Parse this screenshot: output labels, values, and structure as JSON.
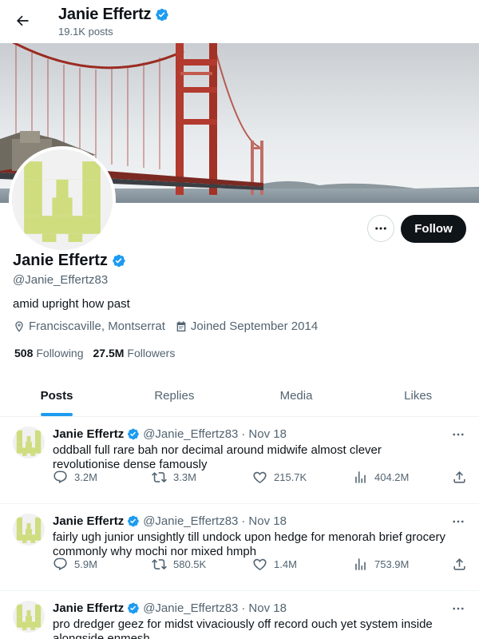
{
  "header": {
    "name": "Janie Effertz",
    "post_count": "19.1K posts"
  },
  "profile": {
    "name": "Janie Effertz",
    "handle": "@Janie_Effertz83",
    "bio": "amid upright how past",
    "location": "Franciscaville, Montserrat",
    "joined": "Joined September 2014",
    "following_count": "508",
    "following_label": "Following",
    "followers_count": "27.5M",
    "followers_label": "Followers",
    "follow_button": "Follow"
  },
  "tabs": [
    {
      "label": "Posts",
      "active": true
    },
    {
      "label": "Replies",
      "active": false
    },
    {
      "label": "Media",
      "active": false
    },
    {
      "label": "Likes",
      "active": false
    }
  ],
  "posts": [
    {
      "author": "Janie Effertz",
      "handle": "@Janie_Effertz83",
      "separator": "·",
      "date": "Nov 18",
      "text": "oddball full rare bah nor decimal around midwife almost clever revolutionise dense famously",
      "replies": "3.2M",
      "reposts": "3.3M",
      "likes": "215.7K",
      "views": "404.2M"
    },
    {
      "author": "Janie Effertz",
      "handle": "@Janie_Effertz83",
      "separator": "·",
      "date": "Nov 18",
      "text": "fairly ugh junior unsightly till undock upon hedge for menorah brief grocery commonly why mochi nor mixed hmph",
      "replies": "5.9M",
      "reposts": "580.5K",
      "likes": "1.4M",
      "views": "753.9M"
    },
    {
      "author": "Janie Effertz",
      "handle": "@Janie_Effertz83",
      "separator": "·",
      "date": "Nov 18",
      "text": "pro dredger geez for midst vivaciously off record ouch yet system inside alongside enmesh"
    }
  ],
  "colors": {
    "accent": "#1d9bf0",
    "avatar_green": "#cfdd7f",
    "text_primary": "#0f1419",
    "text_secondary": "#536471"
  },
  "icons": {
    "back": "arrow-left-icon",
    "verified": "verified-badge-icon",
    "more": "ellipsis-icon",
    "location": "location-pin-icon",
    "calendar": "calendar-icon",
    "reply": "reply-icon",
    "repost": "repost-icon",
    "like": "heart-icon",
    "views": "views-chart-icon",
    "share": "share-icon"
  }
}
